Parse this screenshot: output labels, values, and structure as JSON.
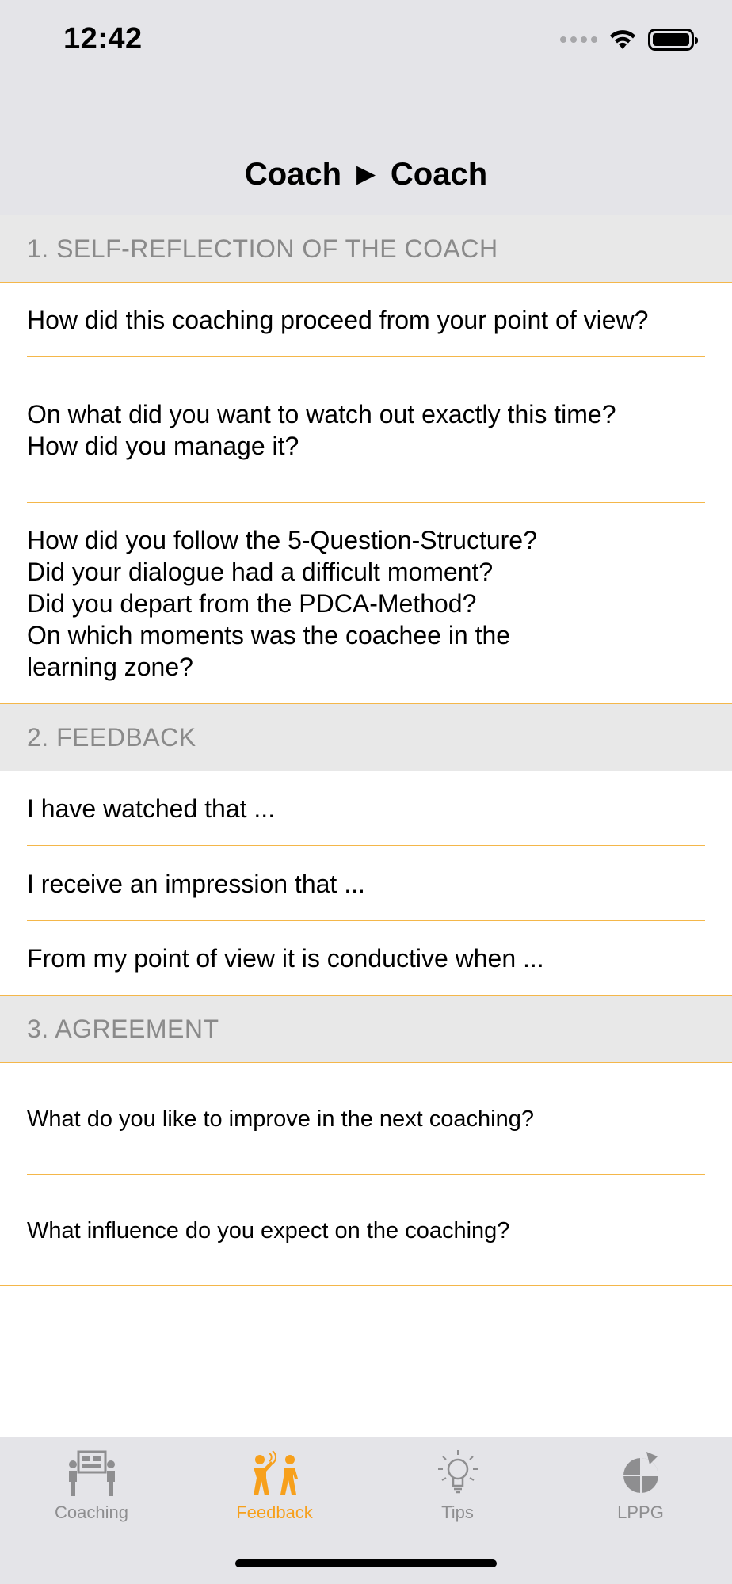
{
  "status_bar": {
    "time": "12:42"
  },
  "nav": {
    "title": "Coach ► Coach"
  },
  "sections": [
    {
      "header": "1. SELF-REFLECTION OF THE COACH",
      "rows": [
        "How did this coaching proceed from your point of view?",
        "On what did you want to watch out exactly this time?\nHow did you manage it?",
        "How did you follow the 5-Question-Structure?\nDid your dialogue had a difficult moment?\nDid you depart from the PDCA-Method?\nOn which moments was the coachee in the\nlearning zone?"
      ]
    },
    {
      "header": "2. FEEDBACK",
      "rows": [
        "I have watched that ...",
        "I receive an impression that ...",
        "From my point of view it is conductive when ..."
      ]
    },
    {
      "header": "3. AGREEMENT",
      "rows": [
        "What do you like to improve in the next coaching?",
        "What influence do you expect on the coaching?"
      ]
    }
  ],
  "tabbar": {
    "tabs": [
      {
        "label": "Coaching",
        "icon": "coaching-icon",
        "active": false
      },
      {
        "label": "Feedback",
        "icon": "feedback-icon",
        "active": true
      },
      {
        "label": "Tips",
        "icon": "lightbulb-icon",
        "active": false
      },
      {
        "label": "LPPG",
        "icon": "lppg-icon",
        "active": false
      }
    ]
  },
  "colors": {
    "accent": "#f7a01c",
    "separator": "#f4b74a",
    "header_bg": "#e8e8e8",
    "bar_bg": "#e4e4e8",
    "inactive": "#8e8e90"
  }
}
